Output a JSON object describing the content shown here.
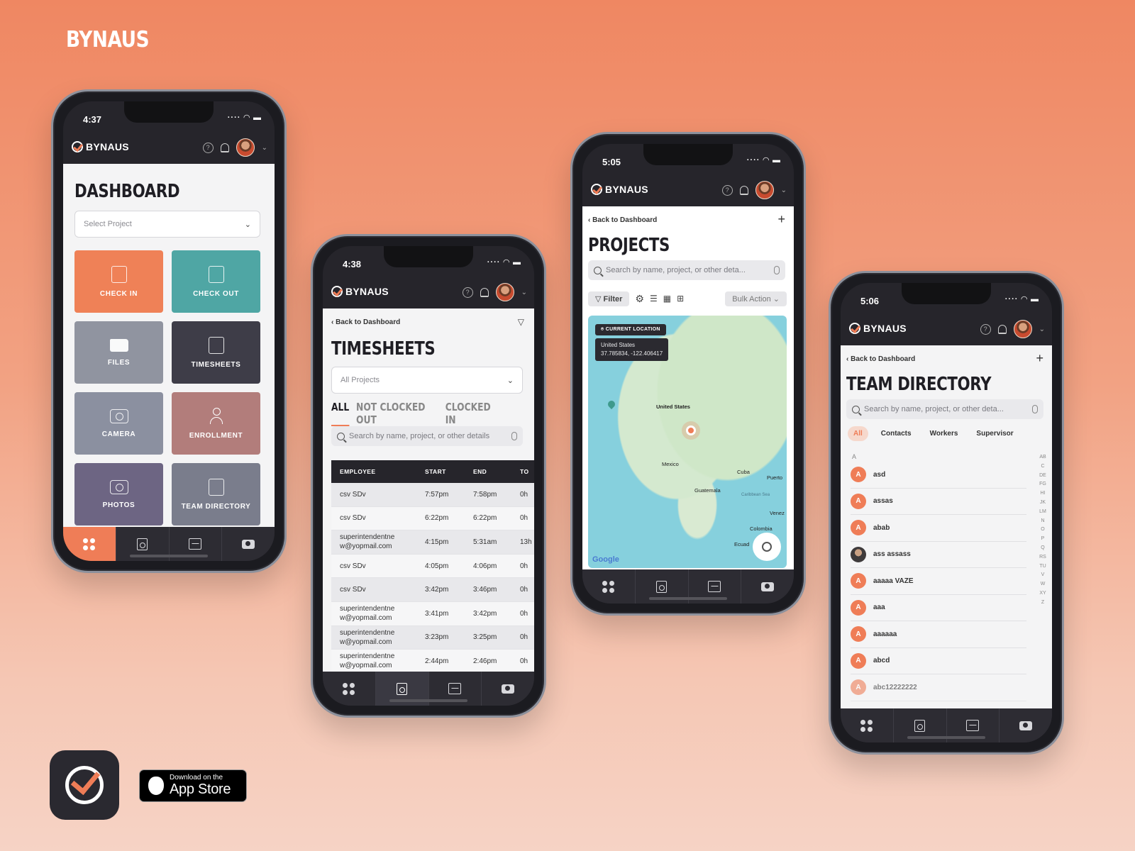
{
  "brand": "BYNAUS",
  "app_name": "BYNAUS",
  "accent": "#ef7d57",
  "dashboard": {
    "time": "4:37",
    "title": "DASHBOARD",
    "select_placeholder": "Select Project",
    "tiles": [
      {
        "label": "CHECK IN",
        "color": "#ef8157",
        "icon": "check-in-icon"
      },
      {
        "label": "CHECK OUT",
        "color": "#4fa6a4",
        "icon": "check-out-icon"
      },
      {
        "label": "FILES",
        "color": "#9094a0",
        "icon": "folder-icon"
      },
      {
        "label": "TIMESHEETS",
        "color": "#3e3d48",
        "icon": "clock-doc-icon"
      },
      {
        "label": "CAMERA",
        "color": "#8b90a0",
        "icon": "camera-icon"
      },
      {
        "label": "ENROLLMENT",
        "color": "#b27d7b",
        "icon": "person-icon"
      },
      {
        "label": "PHOTOS",
        "color": "#6d6583",
        "icon": "photos-icon"
      },
      {
        "label": "TEAM DIRECTORY",
        "color": "#7a7d8c",
        "icon": "contact-card-icon"
      }
    ]
  },
  "timesheets": {
    "time": "4:38",
    "back": "Back to Dashboard",
    "title": "TIMESHEETS",
    "select_placeholder": "All Projects",
    "tabs": [
      "ALL",
      "NOT CLOCKED OUT",
      "CLOCKED IN"
    ],
    "search_placeholder": "Search by name, project, or other details",
    "columns": [
      "EMPLOYEE",
      "START",
      "END",
      "TO"
    ],
    "rows": [
      {
        "employee": "csv SDv",
        "start": "7:57pm",
        "end": "7:58pm",
        "to": "0h"
      },
      {
        "employee": "csv SDv",
        "start": "6:22pm",
        "end": "6:22pm",
        "to": "0h"
      },
      {
        "employee": "superintendentne w@yopmail.com",
        "start": "4:15pm",
        "end": "5:31am",
        "to": "13h"
      },
      {
        "employee": "csv SDv",
        "start": "4:05pm",
        "end": "4:06pm",
        "to": "0h"
      },
      {
        "employee": "csv SDv",
        "start": "3:42pm",
        "end": "3:46pm",
        "to": "0h"
      },
      {
        "employee": "superintendentne w@yopmail.com",
        "start": "3:41pm",
        "end": "3:42pm",
        "to": "0h"
      },
      {
        "employee": "superintendentne w@yopmail.com",
        "start": "3:23pm",
        "end": "3:25pm",
        "to": "0h"
      },
      {
        "employee": "superintendentne w@yopmail.com",
        "start": "2:44pm",
        "end": "2:46pm",
        "to": "0h"
      }
    ]
  },
  "projects": {
    "time": "5:05",
    "back": "Back to Dashboard",
    "title": "PROJECTS",
    "search_placeholder": "Search by name, project, or other deta...",
    "filter_label": "Filter",
    "bulk_label": "Bulk Action",
    "map": {
      "chip": "CURRENT LOCATION",
      "popup_line1": "United States",
      "popup_line2": "37.785834, -122.406417",
      "labels": [
        "United States",
        "Mexico",
        "Cuba",
        "Guatemala",
        "Venez",
        "Colombia",
        "Ecuad",
        "Puerto",
        "Caribbean Sea"
      ],
      "google": "Google"
    }
  },
  "team": {
    "time": "5:06",
    "back": "Back to Dashboard",
    "title": "TEAM DIRECTORY",
    "search_placeholder": "Search by name, project, or other deta...",
    "filters": [
      "All",
      "Contacts",
      "Workers",
      "Supervisor"
    ],
    "section_letter": "A",
    "members": [
      {
        "name": "asd",
        "initial": "A",
        "photo": false
      },
      {
        "name": "assas",
        "initial": "A",
        "photo": false
      },
      {
        "name": "abab",
        "initial": "A",
        "photo": false
      },
      {
        "name": "ass assass",
        "initial": "",
        "photo": true
      },
      {
        "name": "aaaaa VAZE",
        "initial": "A",
        "photo": false
      },
      {
        "name": "aaa",
        "initial": "A",
        "photo": false
      },
      {
        "name": "aaaaaa",
        "initial": "A",
        "photo": false
      },
      {
        "name": "abcd",
        "initial": "A",
        "photo": false
      },
      {
        "name": "abc12222222",
        "initial": "A",
        "photo": false
      }
    ],
    "alphabet": "ABCDEFGHIJKLMNOPQRSTUVWXYZ"
  },
  "appstore": {
    "small": "Download on the",
    "big": "App Store"
  }
}
